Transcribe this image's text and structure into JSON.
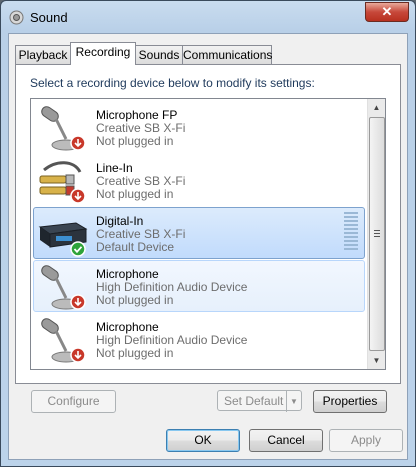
{
  "window": {
    "title": "Sound",
    "close_label": "✕"
  },
  "tabs": [
    {
      "label": "Playback"
    },
    {
      "label": "Recording"
    },
    {
      "label": "Sounds"
    },
    {
      "label": "Communications"
    }
  ],
  "prompt": "Select a recording device below to modify its settings:",
  "devices": [
    {
      "name": "Microphone FP",
      "driver": "Creative SB X-Fi",
      "status": "Not plugged in",
      "icon": "microphone-icon",
      "badge": "red-down-arrow"
    },
    {
      "name": "Line-In",
      "driver": "Creative SB X-Fi",
      "status": "Not plugged in",
      "icon": "rca-cable-icon",
      "badge": "red-down-arrow"
    },
    {
      "name": "Digital-In",
      "driver": "Creative SB X-Fi",
      "status": "Default Device",
      "icon": "digital-device-icon",
      "badge": "green-check"
    },
    {
      "name": "Microphone",
      "driver": "High Definition Audio Device",
      "status": "Not plugged in",
      "icon": "microphone-icon",
      "badge": "red-down-arrow"
    },
    {
      "name": "Microphone",
      "driver": "High Definition Audio Device",
      "status": "Not plugged in",
      "icon": "microphone-icon",
      "badge": "red-down-arrow"
    }
  ],
  "buttons": {
    "configure": "Configure",
    "set_default": "Set Default",
    "properties": "Properties",
    "ok": "OK",
    "cancel": "Cancel",
    "apply": "Apply"
  }
}
